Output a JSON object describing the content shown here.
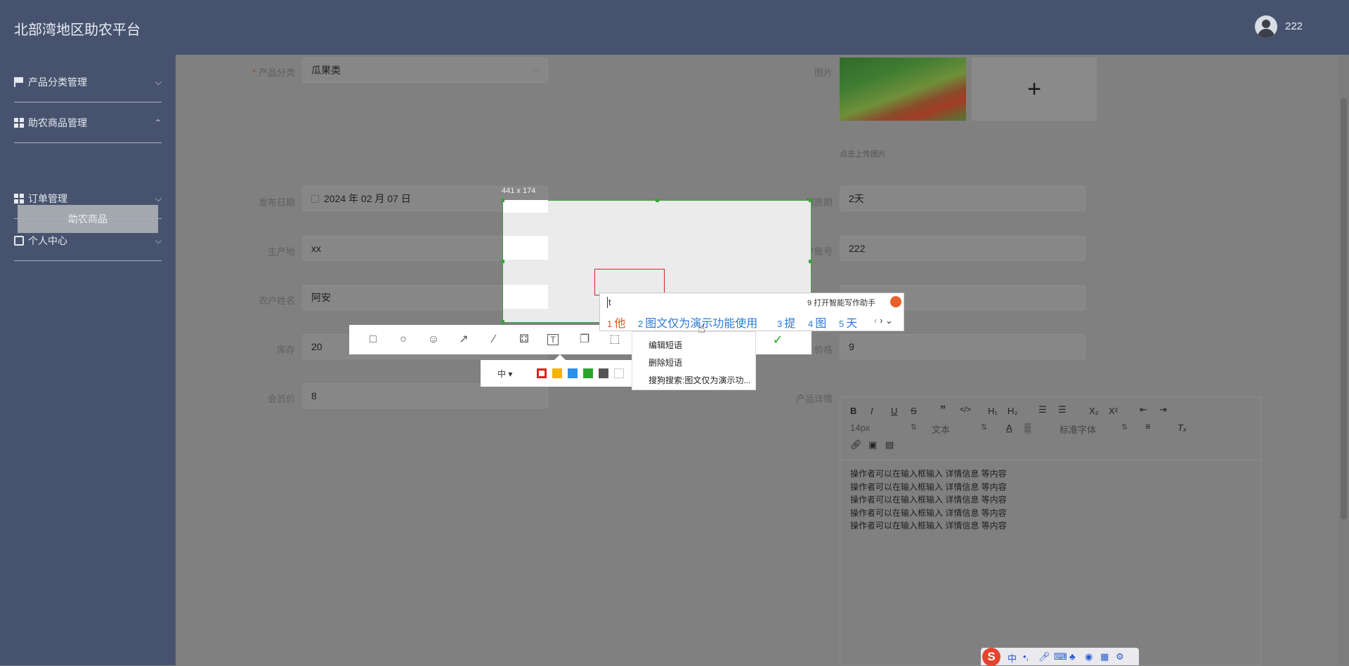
{
  "app": {
    "title": "北部湾地区助农平台",
    "username": "222"
  },
  "sidebar": {
    "items": [
      {
        "label": "产品分类管理",
        "icon": "flag-icon"
      },
      {
        "label": "助农商品管理",
        "icon": "grid-icon"
      },
      {
        "label": "订单管理",
        "icon": "grid-icon"
      },
      {
        "label": "个人中心",
        "icon": "card-icon"
      }
    ],
    "sub_item": "助农商品"
  },
  "form": {
    "category": {
      "label": "产品分类",
      "value": "瓜果类"
    },
    "image_label": "图片",
    "upload_hint": "点击上传图片",
    "publish_date": {
      "label": "发布日期",
      "value": "2024 年 02 月 07 日"
    },
    "shelf_life": {
      "label": "保质期",
      "value": "2天"
    },
    "origin": {
      "label": "生产地",
      "value": "xx"
    },
    "farmer_account": {
      "label": "农户账号",
      "value": "222"
    },
    "farmer_name": {
      "label": "农户姓名",
      "value": "阿安"
    },
    "stock": {
      "label": "库存",
      "value": "20"
    },
    "price": {
      "label": "价格",
      "value": "9"
    },
    "member_price": {
      "label": "会员价",
      "value": "8"
    },
    "detail_label": "产品详情"
  },
  "editor": {
    "font_size": "14px",
    "block_type": "文本",
    "font_family": "标准字体",
    "lines": [
      "操作者可以在输入框输入  详情信息  等内容",
      "操作者可以在输入框输入  详情信息  等内容",
      "操作者可以在输入框输入  详情信息  等内容",
      "操作者可以在输入框输入  详情信息  等内容",
      "操作者可以在输入框输入  详情信息  等内容"
    ]
  },
  "screenshot_overlay": {
    "size_label": "441 x 174",
    "size_selector": "中",
    "colors": [
      "#e02020",
      "#f5b400",
      "#2f8fe6",
      "#2aa52a",
      "#555555",
      "#ffffff"
    ]
  },
  "ime": {
    "input": "t",
    "hint": "9 打开智能写作助手",
    "candidates": [
      {
        "num": "1",
        "text": "他"
      },
      {
        "num": "2",
        "text": "图文仅为演示功能使用"
      },
      {
        "num": "3",
        "text": "提"
      },
      {
        "num": "4",
        "text": "图"
      },
      {
        "num": "5",
        "text": "天"
      }
    ]
  },
  "context_menu": [
    "编辑短语",
    "删除短语",
    "搜狗搜索:图文仅为演示功..."
  ],
  "sogou_bar": {
    "lang": "中"
  }
}
